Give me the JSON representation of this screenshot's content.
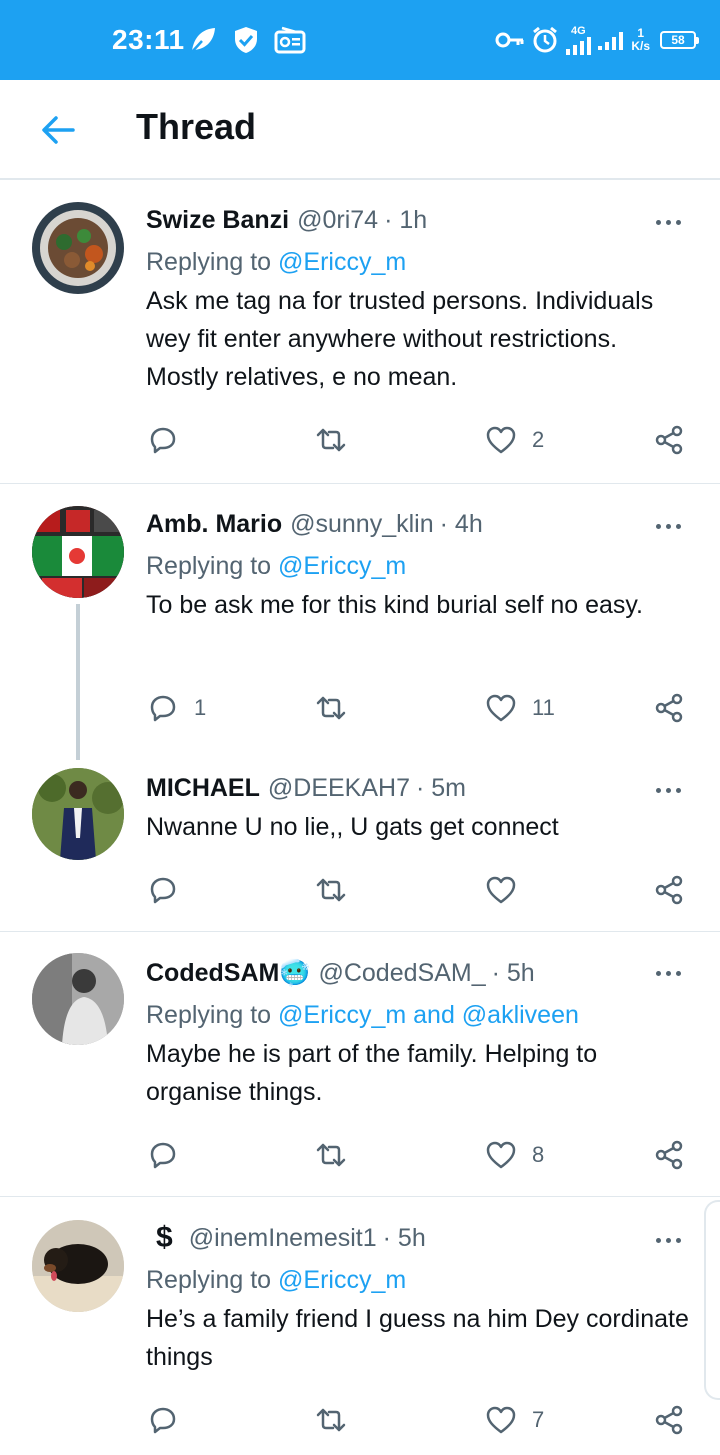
{
  "status_bar": {
    "time": "23:11",
    "network": "4G",
    "speed_value": "1",
    "speed_unit": "K/s",
    "battery": "58"
  },
  "header": {
    "title": "Thread"
  },
  "tweets": [
    {
      "name": "Swize Banzi",
      "handle": "@0ri74",
      "time": "· 1h",
      "replying_prefix": "Replying to",
      "replying_to": "@Ericcy_m",
      "text": "Ask me tag na for trusted persons. Individuals wey fit enter anywhere without restrictions. Mostly relatives, e no mean.",
      "reply_count": "",
      "like_count": "2"
    },
    {
      "name": "Amb. Mario",
      "handle": "@sunny_klin",
      "time": "· 4h",
      "replying_prefix": "Replying to",
      "replying_to": "@Ericcy_m",
      "text": "To be ask me for this kind burial self no easy.",
      "reply_count": "1",
      "like_count": "11"
    },
    {
      "name": "MICHAEL",
      "handle": "@DEEKAH7",
      "time": "· 5m",
      "text": "Nwanne U no lie,, U gats get connect",
      "reply_count": "",
      "like_count": ""
    },
    {
      "name": "CodedSAM",
      "name_emoji": "🥶",
      "handle": "@CodedSAM_",
      "time": "· 5h",
      "replying_prefix": "Replying to",
      "replying_to": "@Ericcy_m and @akliveen",
      "text": "Maybe he is part of the family. Helping to organise things.",
      "reply_count": "",
      "like_count": "8"
    },
    {
      "name": "$",
      "handle": "@inemInemesit1",
      "time": "· 5h",
      "replying_prefix": "Replying to",
      "replying_to": "@Ericcy_m",
      "text": "He’s a family friend I guess na him Dey cordinate things",
      "reply_count": "",
      "like_count": "7"
    }
  ],
  "colors": {
    "accent": "#1da1f2",
    "text": "#0f1419",
    "muted": "#536471",
    "divider": "#e1e8ed"
  },
  "icons": [
    "back-arrow-icon",
    "reply-icon",
    "retweet-icon",
    "like-icon",
    "share-icon",
    "more-icon"
  ]
}
